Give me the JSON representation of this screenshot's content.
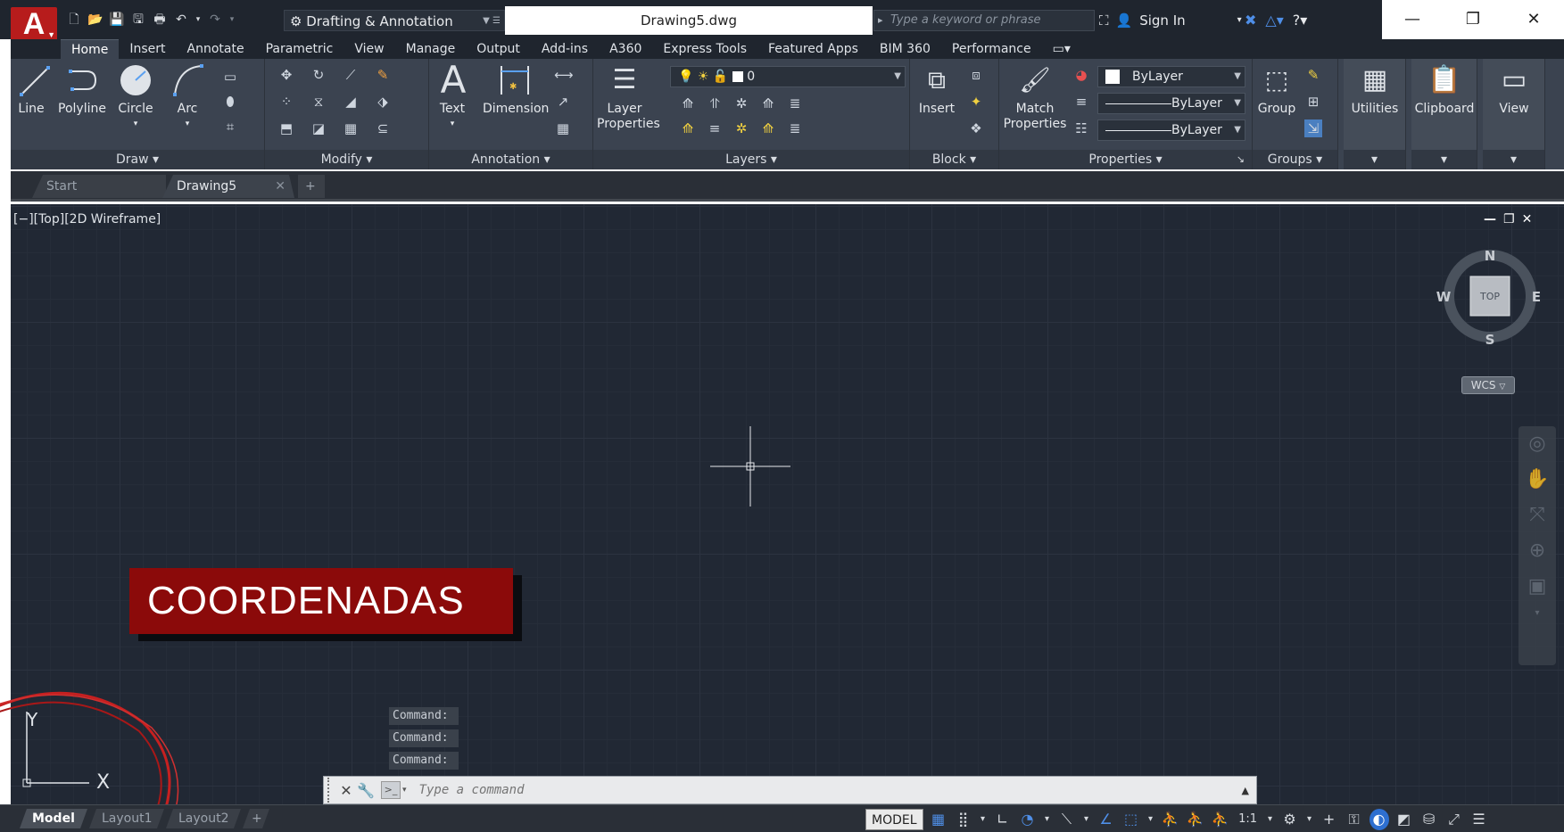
{
  "titlebar": {
    "app_logo": "A",
    "workspace": "Drafting & Annotation",
    "filename": "Drawing5.dwg",
    "search_placeholder": "Type a keyword or phrase",
    "sign_in": "Sign In"
  },
  "ribbon_tabs": [
    "Home",
    "Insert",
    "Annotate",
    "Parametric",
    "View",
    "Manage",
    "Output",
    "Add-ins",
    "A360",
    "Express Tools",
    "Featured Apps",
    "BIM 360",
    "Performance"
  ],
  "ribbon": {
    "draw": {
      "title": "Draw",
      "line": "Line",
      "polyline": "Polyline",
      "circle": "Circle",
      "arc": "Arc"
    },
    "modify": {
      "title": "Modify"
    },
    "annotation": {
      "title": "Annotation",
      "text": "Text",
      "dimension": "Dimension"
    },
    "layers": {
      "title": "Layers",
      "layer_properties_1": "Layer",
      "layer_properties_2": "Properties",
      "current_layer": "0"
    },
    "block": {
      "title": "Block",
      "insert": "Insert"
    },
    "properties": {
      "title": "Properties",
      "match_1": "Match",
      "match_2": "Properties",
      "color": "ByLayer",
      "linetype": "ByLayer",
      "lineweight": "ByLayer"
    },
    "groups": {
      "title": "Groups",
      "group": "Group"
    },
    "utilities": "Utilities",
    "clipboard": "Clipboard",
    "view": "View"
  },
  "doc_tabs": {
    "start": "Start",
    "drawing": "Drawing5"
  },
  "viewport": {
    "label": "[−][Top][2D Wireframe]",
    "compass": {
      "n": "N",
      "s": "S",
      "e": "E",
      "w": "W",
      "top": "TOP"
    },
    "wcs": "WCS",
    "banner": "COORDENADAS",
    "ucs_x": "X",
    "ucs_y": "Y"
  },
  "command": {
    "history": [
      "Command:",
      "Command:",
      "Command:"
    ],
    "placeholder": "Type a command"
  },
  "statusbar": {
    "layouts": [
      "Model",
      "Layout1",
      "Layout2"
    ],
    "model": "MODEL",
    "scale": "1:1"
  },
  "colors": {
    "accent_red": "#8b0a0a",
    "app_red": "#b71c1c",
    "viewport_bg": "#212834"
  }
}
